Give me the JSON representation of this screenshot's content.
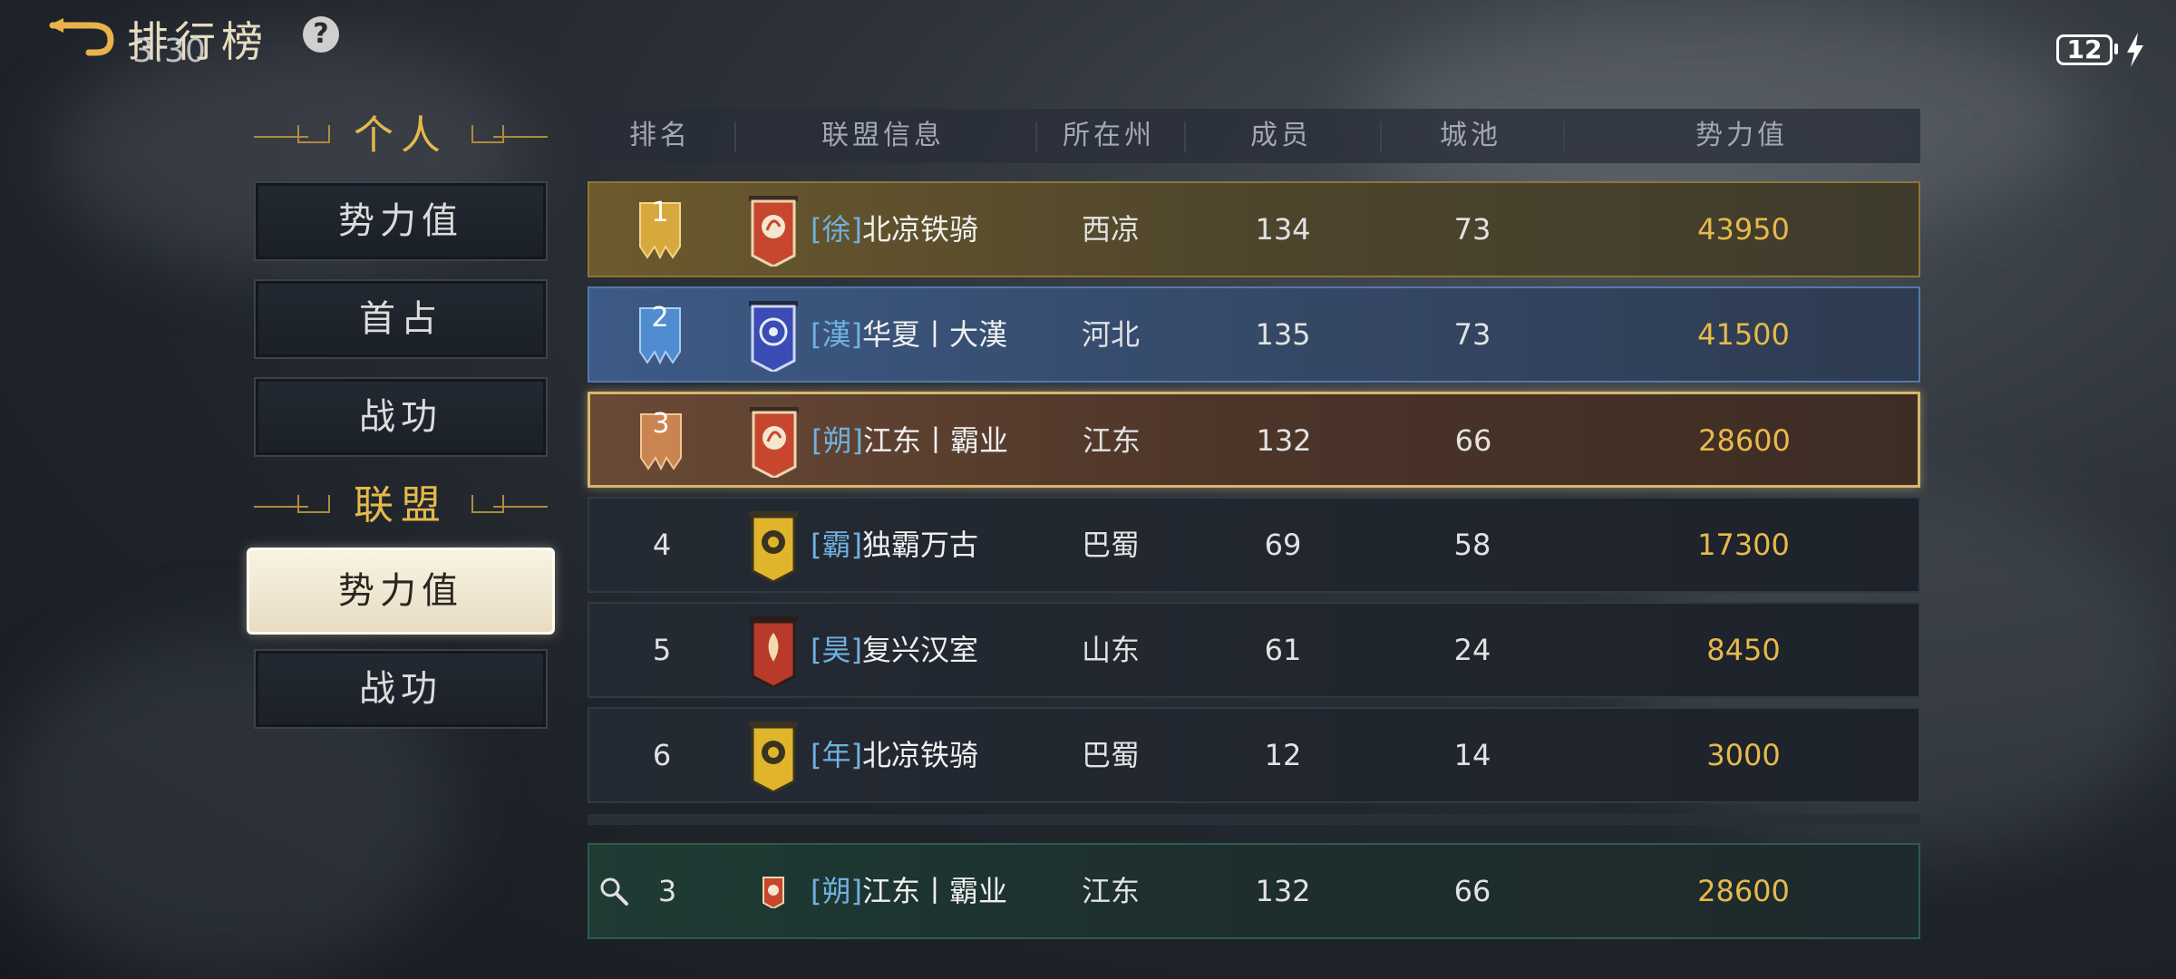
{
  "header": {
    "title": "排行榜",
    "clock": "3:30",
    "battery": "12"
  },
  "sidebar": {
    "personal_label": "个人",
    "alliance_label": "联盟",
    "personal_items": [
      "势力值",
      "首占",
      "战功"
    ],
    "alliance_items": [
      "势力值",
      "战功"
    ],
    "active": "alliance-势力值"
  },
  "table": {
    "headers": [
      "排名",
      "联盟信息",
      "所在州",
      "成员",
      "城池",
      "势力值"
    ],
    "rows": [
      {
        "rank": "1",
        "tag": "[徐]",
        "name": "北凉铁骑",
        "state": "西凉",
        "members": "134",
        "cities": "73",
        "power": "43950",
        "banner": "red-phoenix"
      },
      {
        "rank": "2",
        "tag": "[漢]",
        "name": "华夏丨大漢",
        "state": "河北",
        "members": "135",
        "cities": "73",
        "power": "41500",
        "banner": "blue-dragon"
      },
      {
        "rank": "3",
        "tag": "[朔]",
        "name": "江东丨霸业",
        "state": "江东",
        "members": "132",
        "cities": "66",
        "power": "28600",
        "banner": "red-phoenix"
      },
      {
        "rank": "4",
        "tag": "[霸]",
        "name": "独霸万古",
        "state": "巴蜀",
        "members": "69",
        "cities": "58",
        "power": "17300",
        "banner": "yellow-dragon"
      },
      {
        "rank": "5",
        "tag": "[昊]",
        "name": "复兴汉室",
        "state": "山东",
        "members": "61",
        "cities": "24",
        "power": "8450",
        "banner": "red-flame"
      },
      {
        "rank": "6",
        "tag": "[年]",
        "name": "北凉铁骑",
        "state": "巴蜀",
        "members": "12",
        "cities": "14",
        "power": "3000",
        "banner": "yellow-dragon"
      }
    ],
    "self_row": {
      "rank": "3",
      "tag": "[朔]",
      "name": "江东丨霸业",
      "state": "江东",
      "members": "132",
      "cities": "66",
      "power": "28600"
    }
  },
  "colors": {
    "gold": "#e8b94b",
    "tag_blue": "#6fb1e0",
    "section_gold": "#e5b94a"
  },
  "icons": [
    "back-arrow-icon",
    "help-icon",
    "battery-icon",
    "charging-bolt-icon",
    "search-icon"
  ]
}
